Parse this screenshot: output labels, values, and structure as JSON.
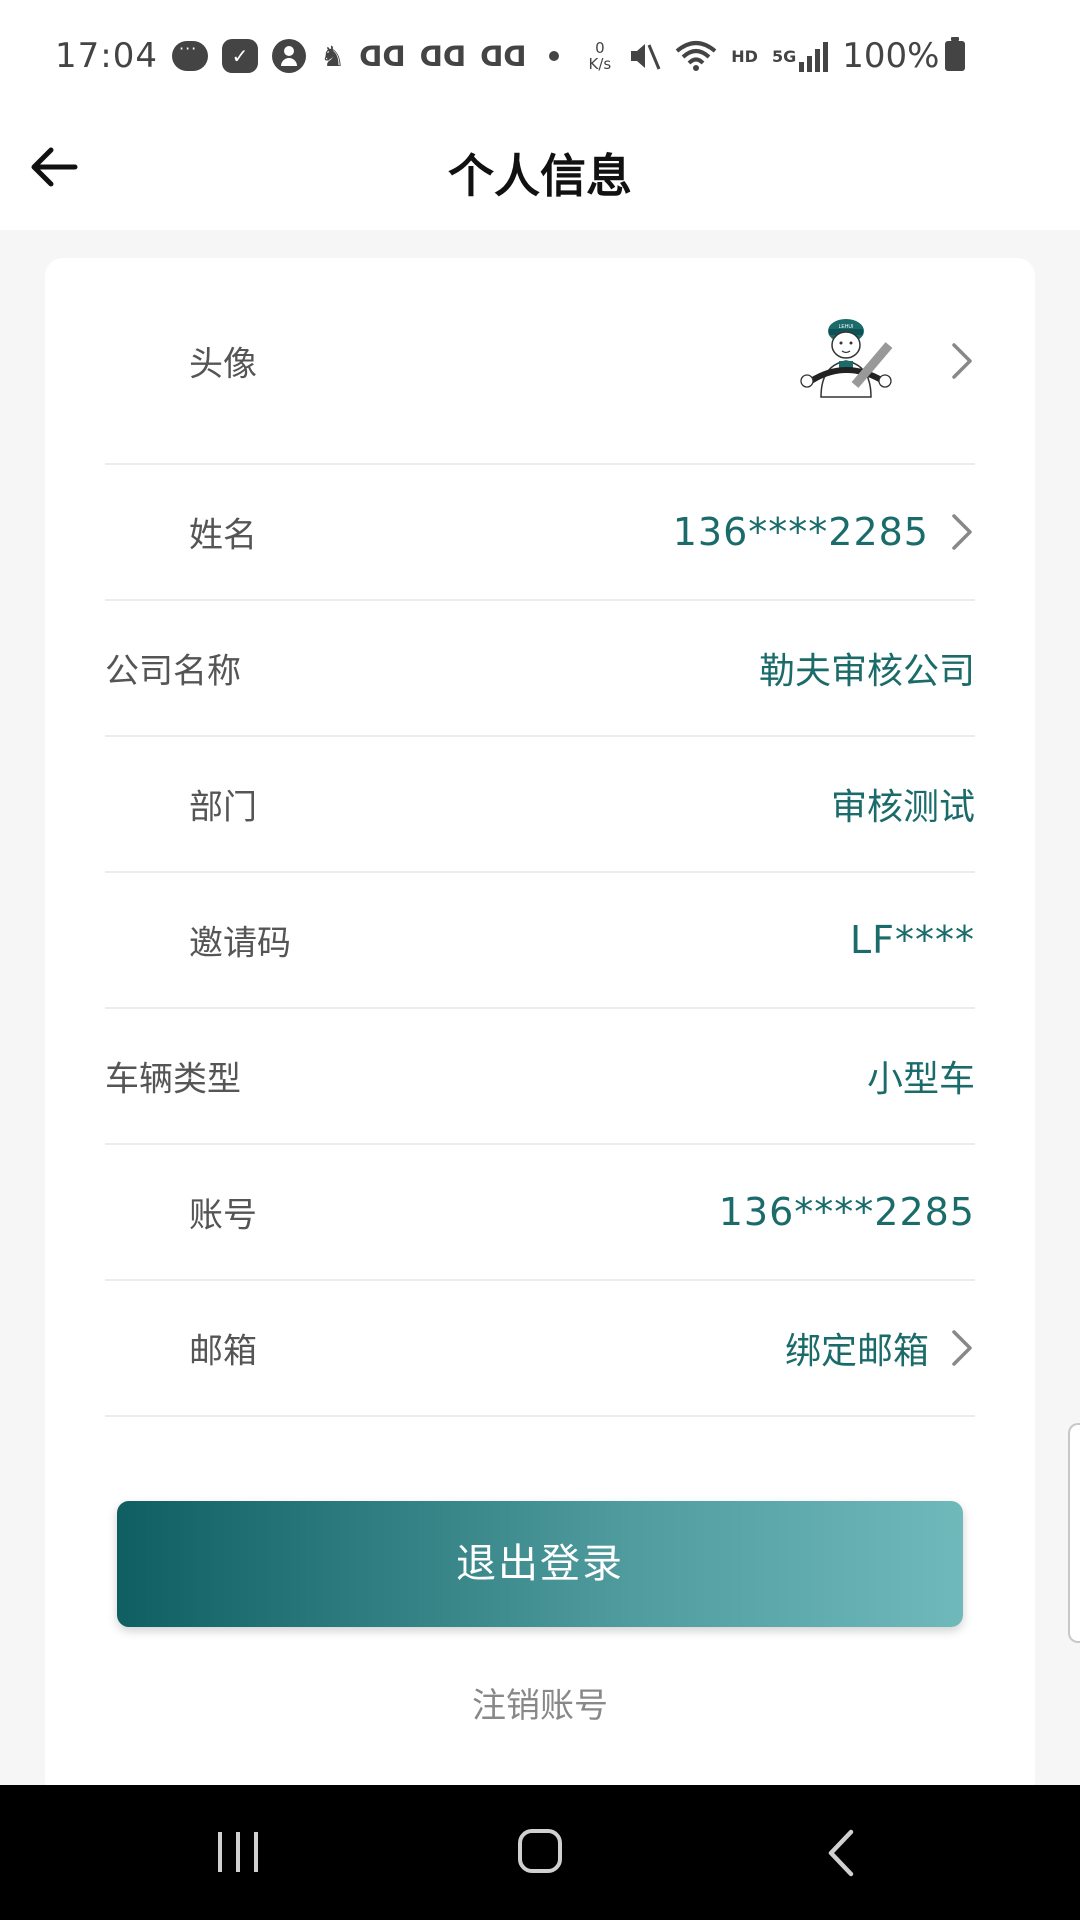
{
  "status_bar": {
    "time": "17:04",
    "speed_value": "0",
    "speed_unit": "K/s",
    "hd": "HD",
    "network": "5G",
    "battery": "100%",
    "icons": [
      "message-icon",
      "checklist-icon",
      "person-icon",
      "app-icon",
      "translate-icon",
      "translate-icon",
      "translate-icon",
      "dot-icon",
      "mute-icon",
      "wifi-icon",
      "signal-icon",
      "battery-icon"
    ]
  },
  "header": {
    "title": "个人信息",
    "back_icon": "arrow-left-icon"
  },
  "rows": {
    "avatar": {
      "label": "头像"
    },
    "name": {
      "label": "姓名",
      "value": "136****2285"
    },
    "company": {
      "label": "公司名称",
      "value": "勒夫审核公司"
    },
    "department": {
      "label": "部门",
      "value": "审核测试"
    },
    "invite": {
      "label": "邀请码",
      "value": "LF****"
    },
    "vehicle": {
      "label": "车辆类型",
      "value": "小型车"
    },
    "account": {
      "label": "账号",
      "value": "136****2285"
    },
    "email": {
      "label": "邮箱",
      "value": "绑定邮箱"
    }
  },
  "actions": {
    "logout_label": "退出登录",
    "cancel_account_label": "注销账号"
  },
  "colors": {
    "accent": "#1b6b6b",
    "button_start": "#0f5f62",
    "button_end": "#6fb9bb"
  },
  "nav_bar": {
    "icons": [
      "recent-apps-icon",
      "home-icon",
      "back-icon"
    ]
  }
}
